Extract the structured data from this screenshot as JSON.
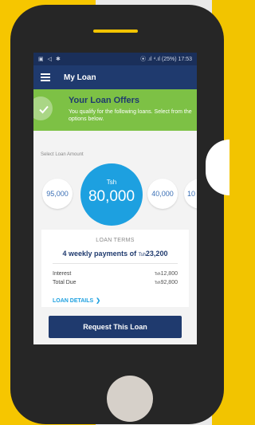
{
  "statusbar": {
    "left_icons": [
      "▣",
      "◁",
      "✱"
    ],
    "right_text": "⦿ .ıl ⁴.ıl (25%) 17:53",
    "time": "17:53"
  },
  "appbar": {
    "title": "My Loan"
  },
  "offers": {
    "title": "Your Loan Offers",
    "subtitle": "You qualify for the following loans. Select from the options below."
  },
  "select_label": "Select Loan Amount",
  "amounts": {
    "left": "95,000",
    "selected_currency": "Tsh",
    "selected": "80,000",
    "right": "40,000",
    "far_right": "10"
  },
  "terms": {
    "heading": "LOAN TERMS",
    "payments_prefix": "4 weekly payments of ",
    "payments_currency": "Tsh",
    "payments_amount": "23,200",
    "interest_label": "Interest",
    "interest_currency": "Tsh",
    "interest_value": "12,800",
    "total_label": "Total Due",
    "total_currency": "Tsh",
    "total_value": "92,800",
    "details_link": "LOAN DETAILS"
  },
  "request_button": "Request This Loan",
  "colors": {
    "navy": "#1f3a6e",
    "green": "#7dc145",
    "blue": "#1da0e0",
    "yellow": "#f6c600"
  }
}
